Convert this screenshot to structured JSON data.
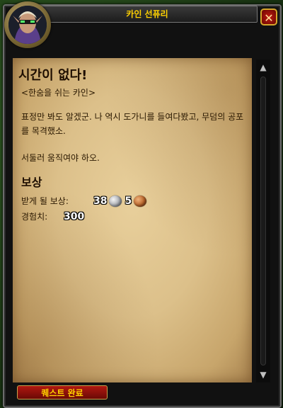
{
  "window": {
    "title": "카인 선퓨리",
    "close_symbol": "✕"
  },
  "quest": {
    "title": "시간이 없다!",
    "subtitle": "<한숨을 쉬는 카인>",
    "paragraphs": [
      "표정만 봐도 알겠군. 나 역시 도가니를 들여다봤고, 무덤의 공포를 목격했소.",
      "서둘러 움직여야 하오."
    ]
  },
  "rewards": {
    "heading": "보상",
    "money_label": "받게 될 보상:",
    "silver": "38",
    "copper": "5",
    "xp_label": "경험치:",
    "xp_value": "300"
  },
  "buttons": {
    "complete_label": "퀘스트 완료"
  },
  "scroll": {
    "up": "▲",
    "down": "▼"
  },
  "icons": {
    "portrait": "blood-elf-portrait-icon",
    "silver": "silver-coin-icon",
    "copper": "copper-coin-icon"
  }
}
